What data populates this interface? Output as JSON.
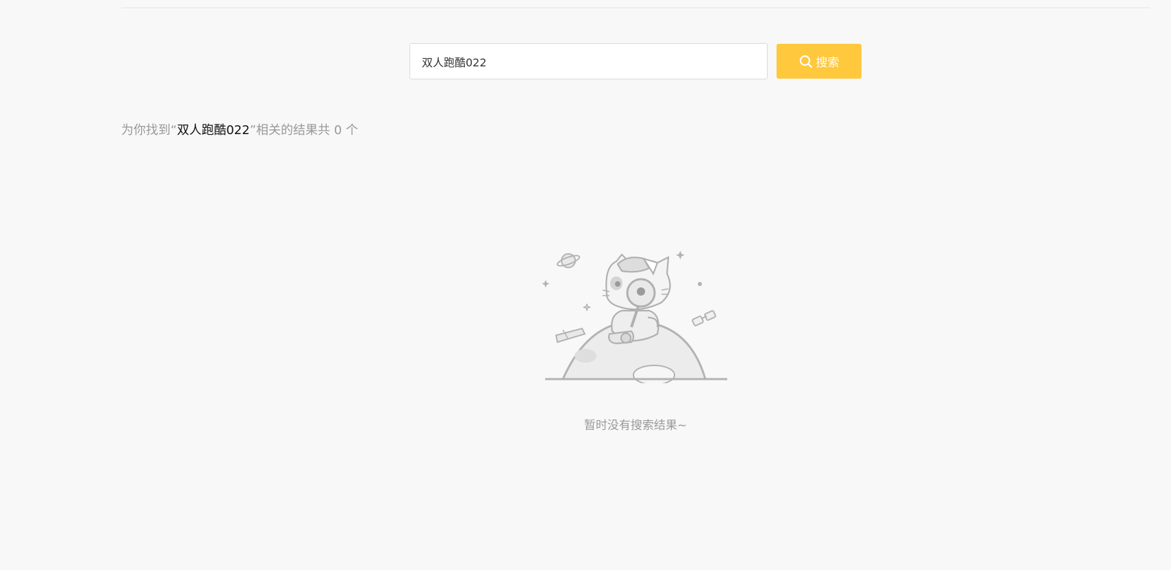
{
  "search": {
    "query": "双人跑酷022",
    "button_label": "搜索"
  },
  "results": {
    "prefix": "为你找到",
    "open_quote": "“",
    "keyword": "双人跑酷022",
    "close_quote": "”",
    "middle": "相关的结果共",
    "count": "0",
    "suffix": "个"
  },
  "empty_state": {
    "message": "暂时没有搜索结果~",
    "illustration": "cat-with-magnifier-on-planet-illustration"
  },
  "colors": {
    "accent": "#ffc83d",
    "background": "#f8f8f8",
    "muted_text": "#999999"
  }
}
